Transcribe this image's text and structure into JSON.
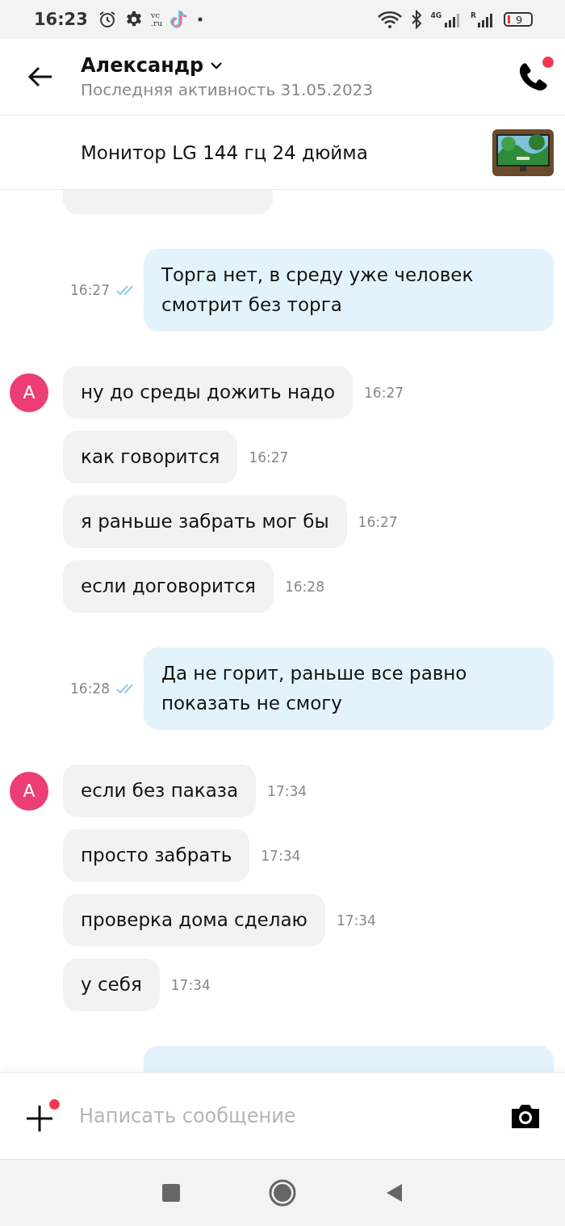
{
  "status_bar": {
    "time": "16:23",
    "app_label": [
      "vc",
      ".ru"
    ],
    "network_labels": [
      "4G",
      "R"
    ],
    "battery": "9"
  },
  "header": {
    "name": "Александр",
    "last_seen": "Последняя активность 31.05.2023",
    "call_notification": true
  },
  "listing": {
    "title": "Монитор LG 144 гц 24 дюйма",
    "kind": "picture"
  },
  "messages": [
    {
      "kind": "incoming_cut"
    },
    {
      "kind": "outgoing",
      "text": "Торга нет, в среду уже человек смотрит без торга",
      "time": "16:27",
      "read": true
    },
    {
      "kind": "incoming",
      "avatar": true,
      "avatar_letter": "А",
      "text": "ну до среды дожить надо",
      "time": "16:27"
    },
    {
      "kind": "incoming",
      "avatar": false,
      "text": "как говорится",
      "time": "16:27"
    },
    {
      "kind": "incoming",
      "avatar": false,
      "text": "я раньше забрать мог бы",
      "time": "16:27"
    },
    {
      "kind": "incoming",
      "avatar": false,
      "text": "если договорится",
      "time": "16:28"
    },
    {
      "kind": "outgoing",
      "text": "Да не горит, раньше все равно показать не смогу",
      "time": "16:28",
      "read": true
    },
    {
      "kind": "incoming",
      "avatar": true,
      "avatar_letter": "А",
      "text": "если без паказа",
      "time": "17:34"
    },
    {
      "kind": "incoming",
      "avatar": false,
      "text": "просто забрать",
      "time": "17:34"
    },
    {
      "kind": "incoming",
      "avatar": false,
      "text": "проверка дома сделаю",
      "time": "17:34"
    },
    {
      "kind": "incoming",
      "avatar": false,
      "text": "у себя",
      "time": "17:34"
    },
    {
      "kind": "outgoing_cut"
    }
  ],
  "composer": {
    "placeholder": "Написать сообщение",
    "attach_notification": true
  }
}
